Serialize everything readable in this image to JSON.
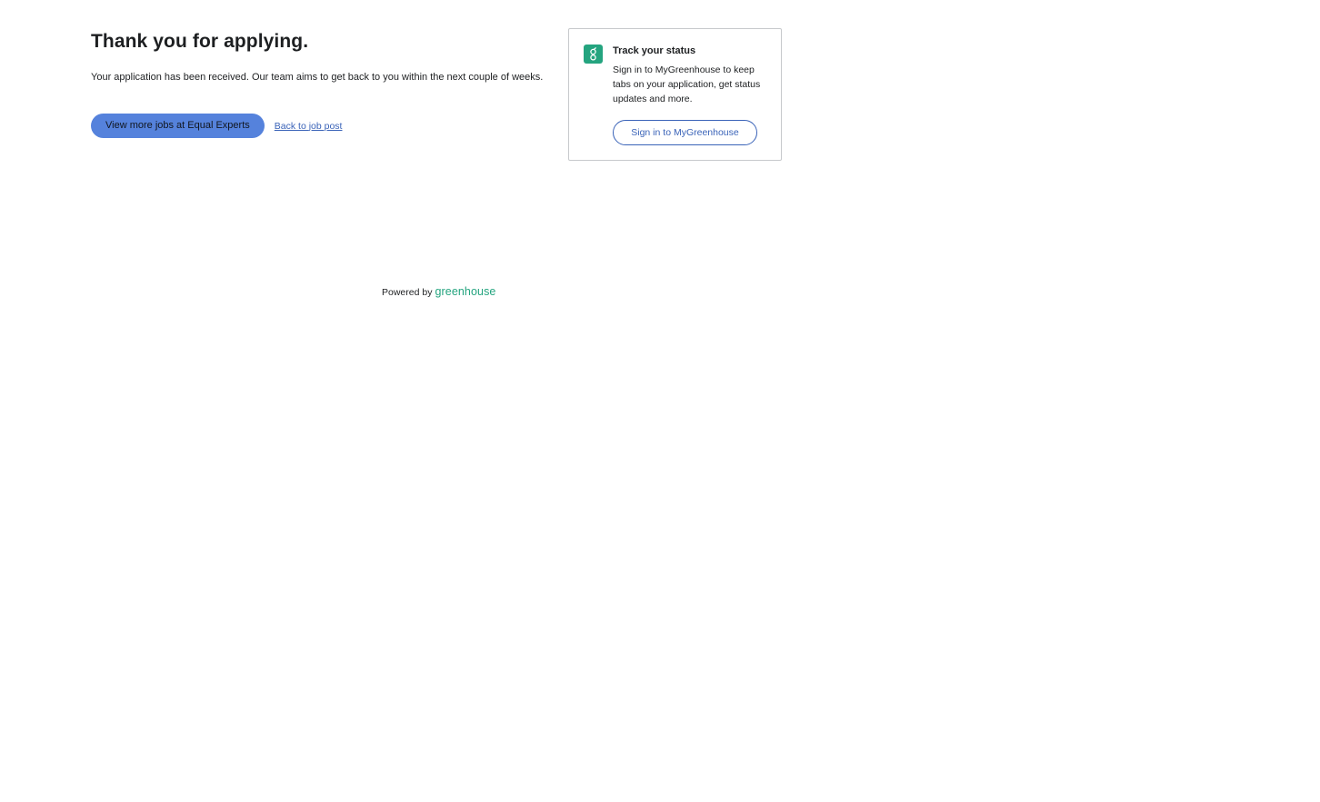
{
  "confirmation": {
    "title": "Thank you for applying.",
    "message": "Your application has been received. Our team aims to get back to you within the next couple of weeks.",
    "primary_button_label": "View more jobs at Equal Experts",
    "back_link_label": "Back to job post"
  },
  "status_card": {
    "logo_icon": "greenhouse-logo-icon",
    "title": "Track your status",
    "description": "Sign in to MyGreenhouse to keep tabs on your application, get status updates and more.",
    "signin_button_label": "Sign in to MyGreenhouse"
  },
  "footer": {
    "powered_by_label": "Powered by",
    "brand_name": "greenhouse"
  },
  "colors": {
    "primary_button": "#5582dc",
    "link": "#3a63b8",
    "brand_green": "#24a47f"
  }
}
